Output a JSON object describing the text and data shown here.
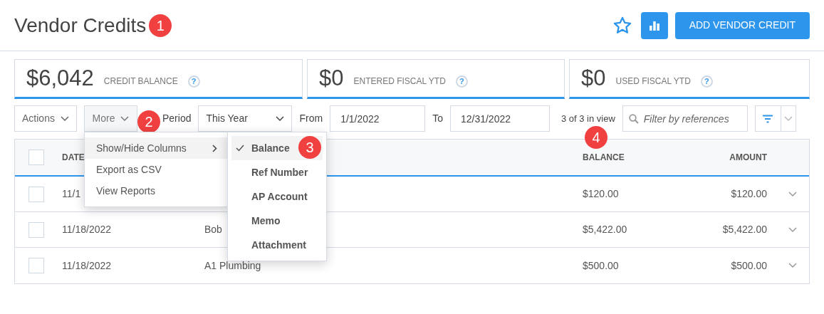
{
  "page": {
    "title": "Vendor Credits",
    "add_button": "ADD VENDOR CREDIT",
    "favorite": false
  },
  "stats": [
    {
      "value": "$6,042",
      "label": "CREDIT BALANCE",
      "help": "?"
    },
    {
      "value": "$0",
      "label": "ENTERED FISCAL YTD",
      "help": "?"
    },
    {
      "value": "$0",
      "label": "USED FISCAL YTD",
      "help": "?"
    }
  ],
  "toolbar": {
    "actions": "Actions",
    "more": "More",
    "period_label": "Period",
    "period": "This Year",
    "from_label": "From",
    "from": "1/1/2022",
    "to_label": "To",
    "to": "12/31/2022",
    "count": "3 of 3 in view",
    "search": {
      "placeholder": "Filter by references"
    }
  },
  "more_menu": [
    {
      "label": "Show/Hide Columns",
      "selected": true,
      "submenu": true
    },
    {
      "label": "Export as CSV",
      "selected": false,
      "submenu": false
    },
    {
      "label": "View Reports",
      "selected": false,
      "submenu": false
    }
  ],
  "columns_menu": [
    {
      "label": "Balance",
      "checked": true,
      "selected": true
    },
    {
      "label": "Ref Number",
      "checked": false,
      "selected": false
    },
    {
      "label": "AP Account",
      "checked": false,
      "selected": false
    },
    {
      "label": "Memo",
      "checked": false,
      "selected": false
    },
    {
      "label": "Attachment",
      "checked": false,
      "selected": false
    }
  ],
  "table": {
    "all_checked": false,
    "columns": {
      "date": "DATE",
      "balance": "BALANCE",
      "amount": "AMOUNT"
    },
    "rows": [
      {
        "date": "11/1",
        "balance": "$120.00",
        "amount": "$120.00",
        "checked": false
      },
      {
        "date": "11/18/2022",
        "vendor": "Bob",
        "balance": "$5,422.00",
        "amount": "$5,422.00",
        "checked": false
      },
      {
        "date": "11/18/2022",
        "vendor": "A1 Plumbing",
        "balance": "$500.00",
        "amount": "$500.00",
        "checked": false
      }
    ]
  },
  "callouts": [
    "1",
    "2",
    "3",
    "4"
  ]
}
